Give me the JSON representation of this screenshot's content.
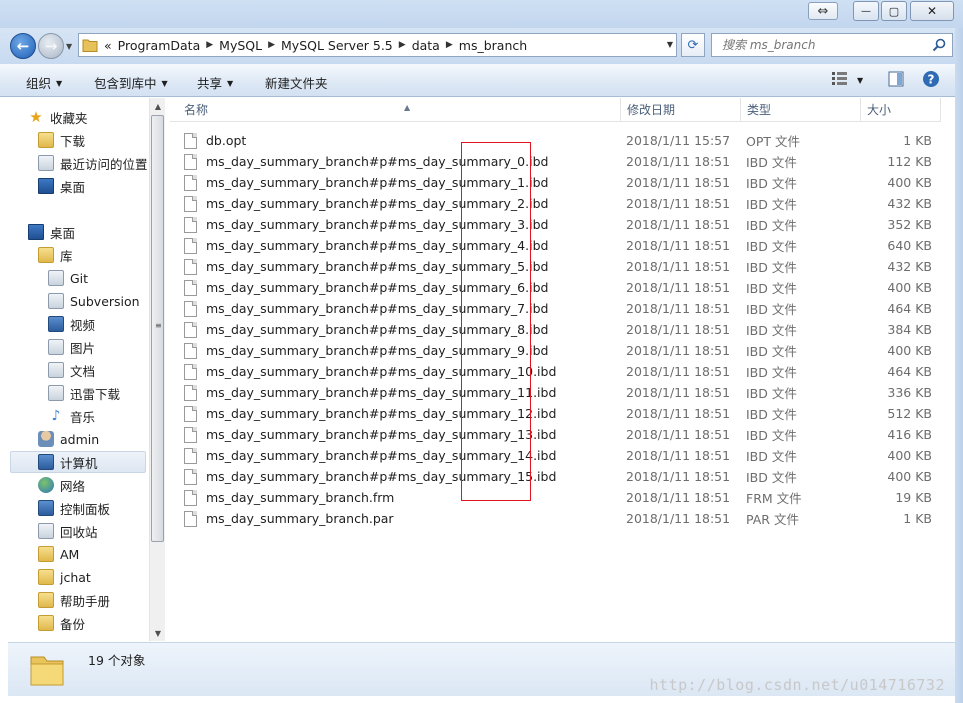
{
  "window": {
    "buttons": {
      "minimize": "—",
      "maximize": "▢",
      "close": "✕"
    }
  },
  "address": {
    "overflow": "«",
    "crumbs": [
      "ProgramData",
      "MySQL",
      "MySQL Server 5.5",
      "data",
      "ms_branch"
    ],
    "search_placeholder": "搜索 ms_branch"
  },
  "toolbar": {
    "organize": "组织",
    "include_in_library": "包含到库中",
    "share": "共享",
    "new_folder": "新建文件夹"
  },
  "nav": {
    "favorites": "收藏夹",
    "downloads": "下载",
    "recent": "最近访问的位置",
    "desktop_fav": "桌面",
    "desktop": "桌面",
    "libraries": "库",
    "git": "Git",
    "subversion": "Subversion",
    "videos": "视频",
    "pictures": "图片",
    "documents": "文档",
    "thunder": "迅雷下载",
    "music": "音乐",
    "admin": "admin",
    "computer": "计算机",
    "network": "网络",
    "control_panel": "控制面板",
    "recycle_bin": "回收站",
    "am": "AM",
    "jchat": "jchat",
    "help_manual": "帮助手册",
    "backup": "备份"
  },
  "columns": {
    "name": "名称",
    "modified": "修改日期",
    "type": "类型",
    "size": "大小"
  },
  "files": [
    {
      "name": "db.opt",
      "date": "2018/1/11 15:57",
      "type": "OPT 文件",
      "size": "1 KB"
    },
    {
      "name": "ms_day_summary_branch#p#ms_day_summary_0.ibd",
      "date": "2018/1/11 18:51",
      "type": "IBD 文件",
      "size": "112 KB"
    },
    {
      "name": "ms_day_summary_branch#p#ms_day_summary_1.ibd",
      "date": "2018/1/11 18:51",
      "type": "IBD 文件",
      "size": "400 KB"
    },
    {
      "name": "ms_day_summary_branch#p#ms_day_summary_2.ibd",
      "date": "2018/1/11 18:51",
      "type": "IBD 文件",
      "size": "432 KB"
    },
    {
      "name": "ms_day_summary_branch#p#ms_day_summary_3.ibd",
      "date": "2018/1/11 18:51",
      "type": "IBD 文件",
      "size": "352 KB"
    },
    {
      "name": "ms_day_summary_branch#p#ms_day_summary_4.ibd",
      "date": "2018/1/11 18:51",
      "type": "IBD 文件",
      "size": "640 KB"
    },
    {
      "name": "ms_day_summary_branch#p#ms_day_summary_5.ibd",
      "date": "2018/1/11 18:51",
      "type": "IBD 文件",
      "size": "432 KB"
    },
    {
      "name": "ms_day_summary_branch#p#ms_day_summary_6.ibd",
      "date": "2018/1/11 18:51",
      "type": "IBD 文件",
      "size": "400 KB"
    },
    {
      "name": "ms_day_summary_branch#p#ms_day_summary_7.ibd",
      "date": "2018/1/11 18:51",
      "type": "IBD 文件",
      "size": "464 KB"
    },
    {
      "name": "ms_day_summary_branch#p#ms_day_summary_8.ibd",
      "date": "2018/1/11 18:51",
      "type": "IBD 文件",
      "size": "384 KB"
    },
    {
      "name": "ms_day_summary_branch#p#ms_day_summary_9.ibd",
      "date": "2018/1/11 18:51",
      "type": "IBD 文件",
      "size": "400 KB"
    },
    {
      "name": "ms_day_summary_branch#p#ms_day_summary_10.ibd",
      "date": "2018/1/11 18:51",
      "type": "IBD 文件",
      "size": "464 KB"
    },
    {
      "name": "ms_day_summary_branch#p#ms_day_summary_11.ibd",
      "date": "2018/1/11 18:51",
      "type": "IBD 文件",
      "size": "336 KB"
    },
    {
      "name": "ms_day_summary_branch#p#ms_day_summary_12.ibd",
      "date": "2018/1/11 18:51",
      "type": "IBD 文件",
      "size": "512 KB"
    },
    {
      "name": "ms_day_summary_branch#p#ms_day_summary_13.ibd",
      "date": "2018/1/11 18:51",
      "type": "IBD 文件",
      "size": "416 KB"
    },
    {
      "name": "ms_day_summary_branch#p#ms_day_summary_14.ibd",
      "date": "2018/1/11 18:51",
      "type": "IBD 文件",
      "size": "400 KB"
    },
    {
      "name": "ms_day_summary_branch#p#ms_day_summary_15.ibd",
      "date": "2018/1/11 18:51",
      "type": "IBD 文件",
      "size": "400 KB"
    },
    {
      "name": "ms_day_summary_branch.frm",
      "date": "2018/1/11 18:51",
      "type": "FRM 文件",
      "size": "19 KB"
    },
    {
      "name": "ms_day_summary_branch.par",
      "date": "2018/1/11 18:51",
      "type": "PAR 文件",
      "size": "1 KB"
    }
  ],
  "status": {
    "item_count": "19 个对象"
  },
  "watermark": "http://blog.csdn.net/u014716732",
  "colors": {
    "highlight_border": "#e0141e",
    "accent": "#2f6bb5"
  }
}
